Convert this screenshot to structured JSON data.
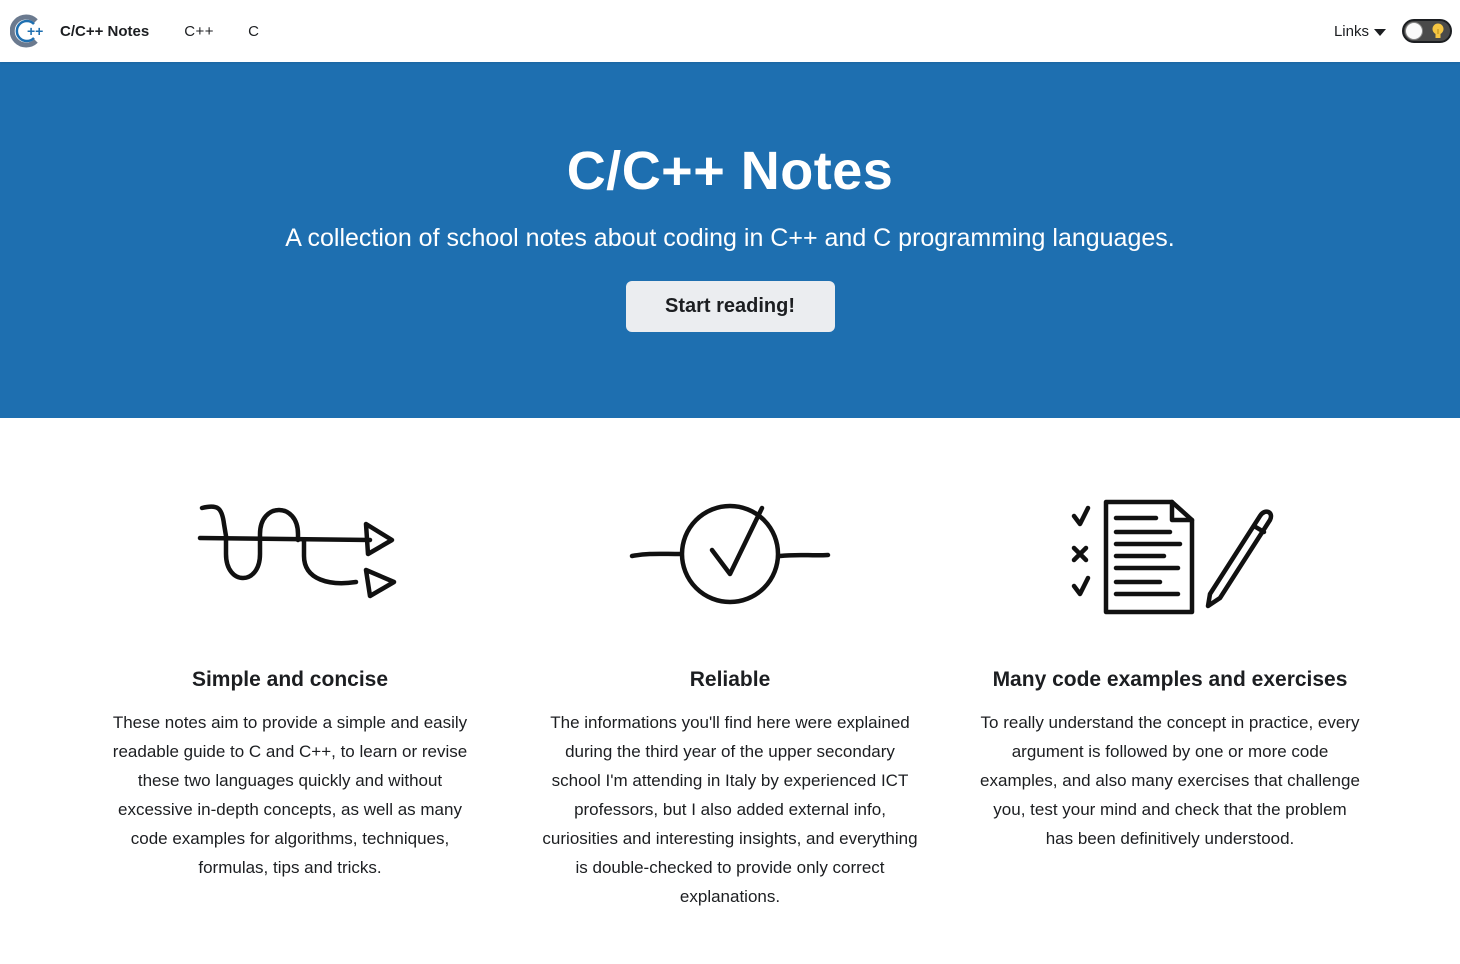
{
  "navbar": {
    "logo_icon": "cpp-logo-icon",
    "brand_title": "C/C++ Notes",
    "links": [
      {
        "label": "C++"
      },
      {
        "label": "C"
      }
    ],
    "dropdown_label": "Links",
    "theme_toggle_icon": "lightbulb-icon"
  },
  "hero": {
    "title": "C/C++ Notes",
    "subtitle": "A collection of school notes about coding in C++ and C programming languages.",
    "button_label": "Start reading!",
    "background_color": "#1e6fb0"
  },
  "features": [
    {
      "icon": "wavy-arrows-icon",
      "title": "Simple and concise",
      "text": "These notes aim to provide a simple and easily readable guide to C and C++, to learn or revise these two languages quickly and without excessive in-depth concepts, as well as many code examples for algorithms, techniques, formulas, tips and tricks."
    },
    {
      "icon": "checkmark-circle-icon",
      "title": "Reliable",
      "text": "The informations you'll find here were explained during the third year of the upper secondary school I'm attending in Italy by experienced ICT professors, but I also added external info, curiosities and interesting insights, and everything is double-checked to provide only correct explanations."
    },
    {
      "icon": "checklist-document-pen-icon",
      "title": "Many code examples and exercises",
      "text": "To really understand the concept in practice, every argument is followed by one or more code examples, and also many exercises that challenge you, test your mind and check that the problem has been definitively understood."
    }
  ]
}
